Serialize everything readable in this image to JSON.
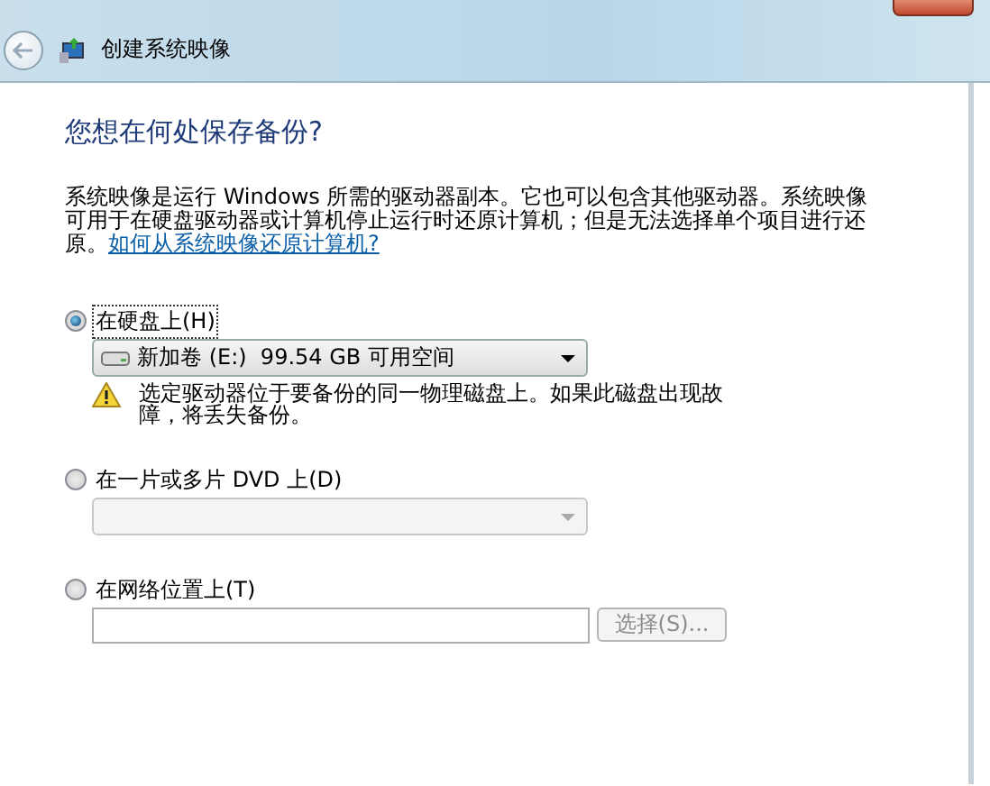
{
  "window": {
    "title": "创建系统映像"
  },
  "heading": "您想在何处保存备份?",
  "description": {
    "text": "系统映像是运行 Windows 所需的驱动器副本。它也可以包含其他驱动器。系统映像可用于在硬盘驱动器或计算机停止运行时还原计算机；但是无法选择单个项目进行还原。",
    "link": "如何从系统映像还原计算机?"
  },
  "options": [
    {
      "kind": "dropdown",
      "label": "在硬盘上(H)",
      "selected": true,
      "disabled": false,
      "value": "新加卷 (E:)  99.54 GB 可用空间",
      "warning": "选定驱动器位于要备份的同一物理磁盘上。如果此磁盘出现故障，将丢失备份。"
    },
    {
      "kind": "dropdown",
      "label": "在一片或多片 DVD 上(D)",
      "selected": false,
      "disabled": true
    },
    {
      "kind": "path",
      "label": "在网络位置上(T)",
      "selected": false,
      "disabled": true,
      "button": "选择(S)..."
    }
  ]
}
